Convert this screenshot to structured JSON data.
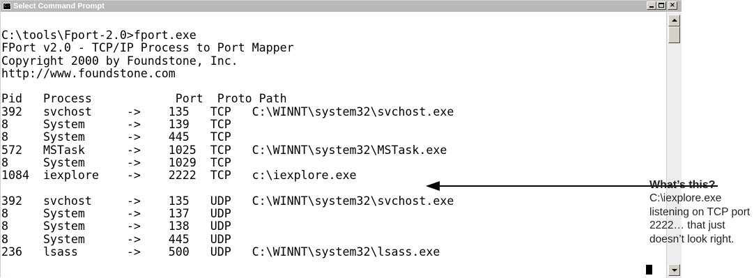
{
  "window": {
    "title": "Select Command Prompt",
    "app_icon_text": "C:\\",
    "buttons": {
      "minimize": "minimize",
      "maximize": "maximize",
      "close": "×"
    }
  },
  "console": {
    "header_lines": [
      "C:\\tools\\Fport-2.0>fport.exe",
      "FPort v2.0 - TCP/IP Process to Port Mapper",
      "Copyright 2000 by Foundstone, Inc.",
      "http://www.foundstone.com"
    ],
    "table_header": "Pid   Process            Port  Proto Path",
    "tcp_rows": [
      "392   svchost     ->    135   TCP   C:\\WINNT\\system32\\svchost.exe",
      "8     System      ->    139   TCP",
      "8     System      ->    445   TCP",
      "572   MSTask      ->    1025  TCP   C:\\WINNT\\system32\\MSTask.exe",
      "8     System      ->    1029  TCP",
      "1084  iexplore    ->    2222  TCP   c:\\iexplore.exe"
    ],
    "udp_rows": [
      "392   svchost     ->    135   UDP   C:\\WINNT\\system32\\svchost.exe",
      "8     System      ->    137   UDP",
      "8     System      ->    138   UDP",
      "8     System      ->    445   UDP",
      "236   lsass       ->    500   UDP   C:\\WINNT\\system32\\lsass.exe"
    ]
  },
  "annotation": {
    "title": "What’s this?",
    "body": "C:\\iexplore.exe listening on TCP port 2222… that just doesn’t look right."
  }
}
